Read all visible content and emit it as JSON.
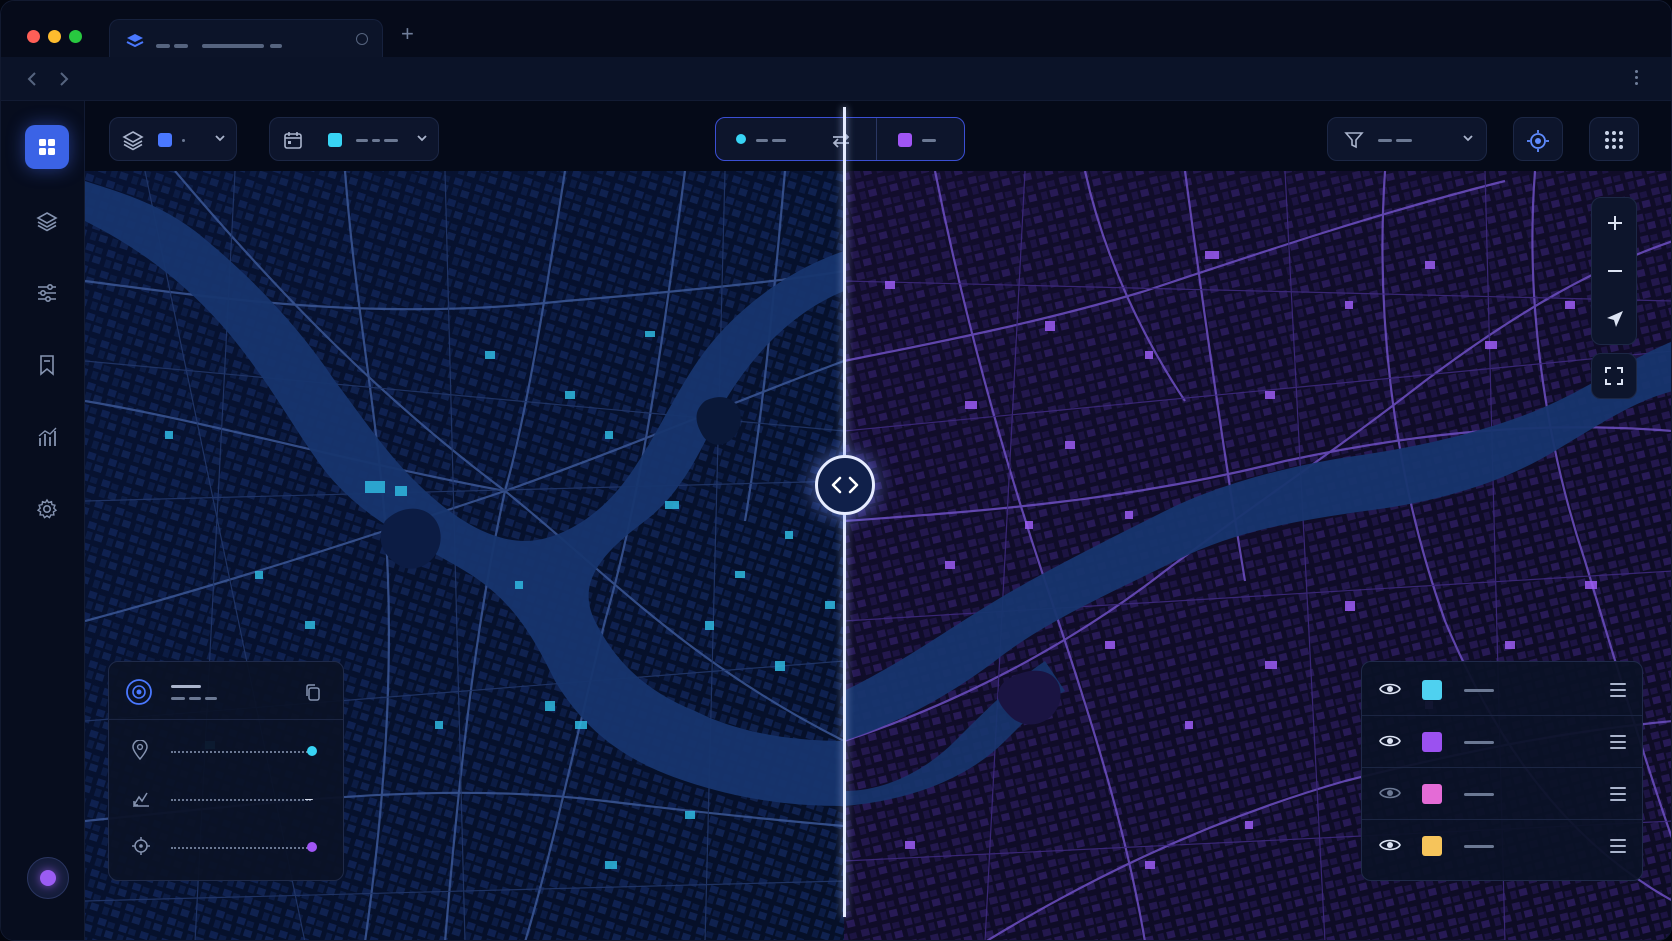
{
  "window": {
    "traffic_lights": [
      "#ff5f57",
      "#febc2e",
      "#28c840"
    ],
    "tab": {
      "icon": "layers-icon",
      "add_label": "+"
    },
    "nav": {
      "back_icon": "chevron-left-icon",
      "forward_icon": "chevron-right-icon",
      "menu_icon": "kebab-icon"
    }
  },
  "sidebar": {
    "items": [
      {
        "icon": "grid-icon",
        "active": true
      },
      {
        "icon": "layers-icon",
        "active": false
      },
      {
        "icon": "sliders-icon",
        "active": false
      },
      {
        "icon": "bookmark-icon",
        "active": false
      },
      {
        "icon": "bar-chart-icon",
        "active": false
      },
      {
        "icon": "gear-icon",
        "active": false
      }
    ],
    "avatar_color": "#9b5cf3"
  },
  "toolbar": {
    "layer_select": {
      "icon": "layers-icon",
      "color": "#4a78ff"
    },
    "date_select": {
      "icon": "calendar-icon",
      "color": "#38d4f5"
    },
    "compare": {
      "left_color": "#38d4f5",
      "swap_icon": "swap-arrows-icon",
      "right_color": "#a055f5"
    },
    "filter": {
      "icon": "filter-icon"
    },
    "locate_icon": "target-icon",
    "apps_icon": "apps-grid-icon"
  },
  "map": {
    "left_theme": "#38d4f5",
    "right_theme": "#a055f5",
    "water_color": "#17356e",
    "compare_handle_icon": "split-arrows-icon"
  },
  "map_tools": [
    "zoom-in-icon",
    "zoom-out-icon",
    "navigate-icon",
    "fullscreen-icon"
  ],
  "info_panel": {
    "header_icon": "radar-icon",
    "copy_icon": "copy-icon",
    "rows": [
      {
        "icon": "pin-icon",
        "status_color": "#38d4f5"
      },
      {
        "icon": "elevation-icon",
        "status": "–"
      },
      {
        "icon": "crosshair-icon",
        "status_color": "#a055f5"
      }
    ]
  },
  "legend": {
    "items": [
      {
        "color": "#4fd1f0",
        "visible": true
      },
      {
        "color": "#9b51f0",
        "visible": true
      },
      {
        "color": "#e46bd6",
        "visible": false
      },
      {
        "color": "#f6c45b",
        "visible": true
      }
    ]
  }
}
